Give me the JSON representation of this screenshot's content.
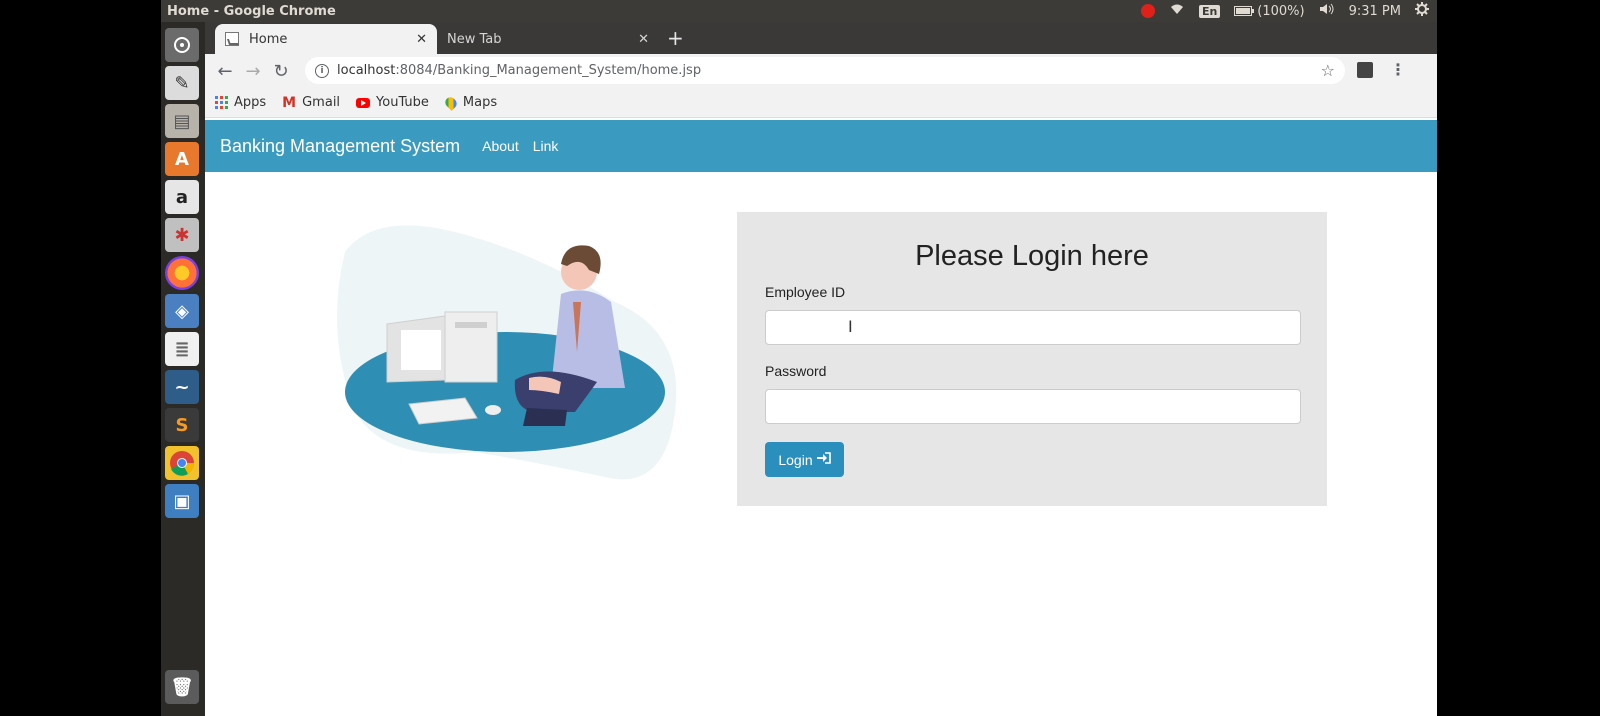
{
  "system_panel": {
    "window_title": "Home - Google Chrome",
    "lang": "En",
    "battery": "(100%)",
    "time": "9:31 PM"
  },
  "browser": {
    "tabs": [
      {
        "label": "Home",
        "active": true
      },
      {
        "label": "New Tab",
        "active": false
      }
    ],
    "new_tab_symbol": "+",
    "url_host": "localhost",
    "url_path": ":8084/Banking_Management_System/home.jsp",
    "bookmarks": [
      {
        "label": "Apps",
        "icon": "apps-icon"
      },
      {
        "label": "Gmail",
        "icon": "gmail-icon"
      },
      {
        "label": "YouTube",
        "icon": "youtube-icon"
      },
      {
        "label": "Maps",
        "icon": "maps-icon"
      }
    ]
  },
  "navbar": {
    "brand": "Banking Management System",
    "links": [
      "About",
      "Link"
    ],
    "color": "#3a9abf"
  },
  "login": {
    "title": "Please Login here",
    "employee_id_label": "Employee ID",
    "employee_id_value": "",
    "password_label": "Password",
    "password_value": "",
    "button_label": "Login",
    "button_color": "#2a8fbd"
  }
}
